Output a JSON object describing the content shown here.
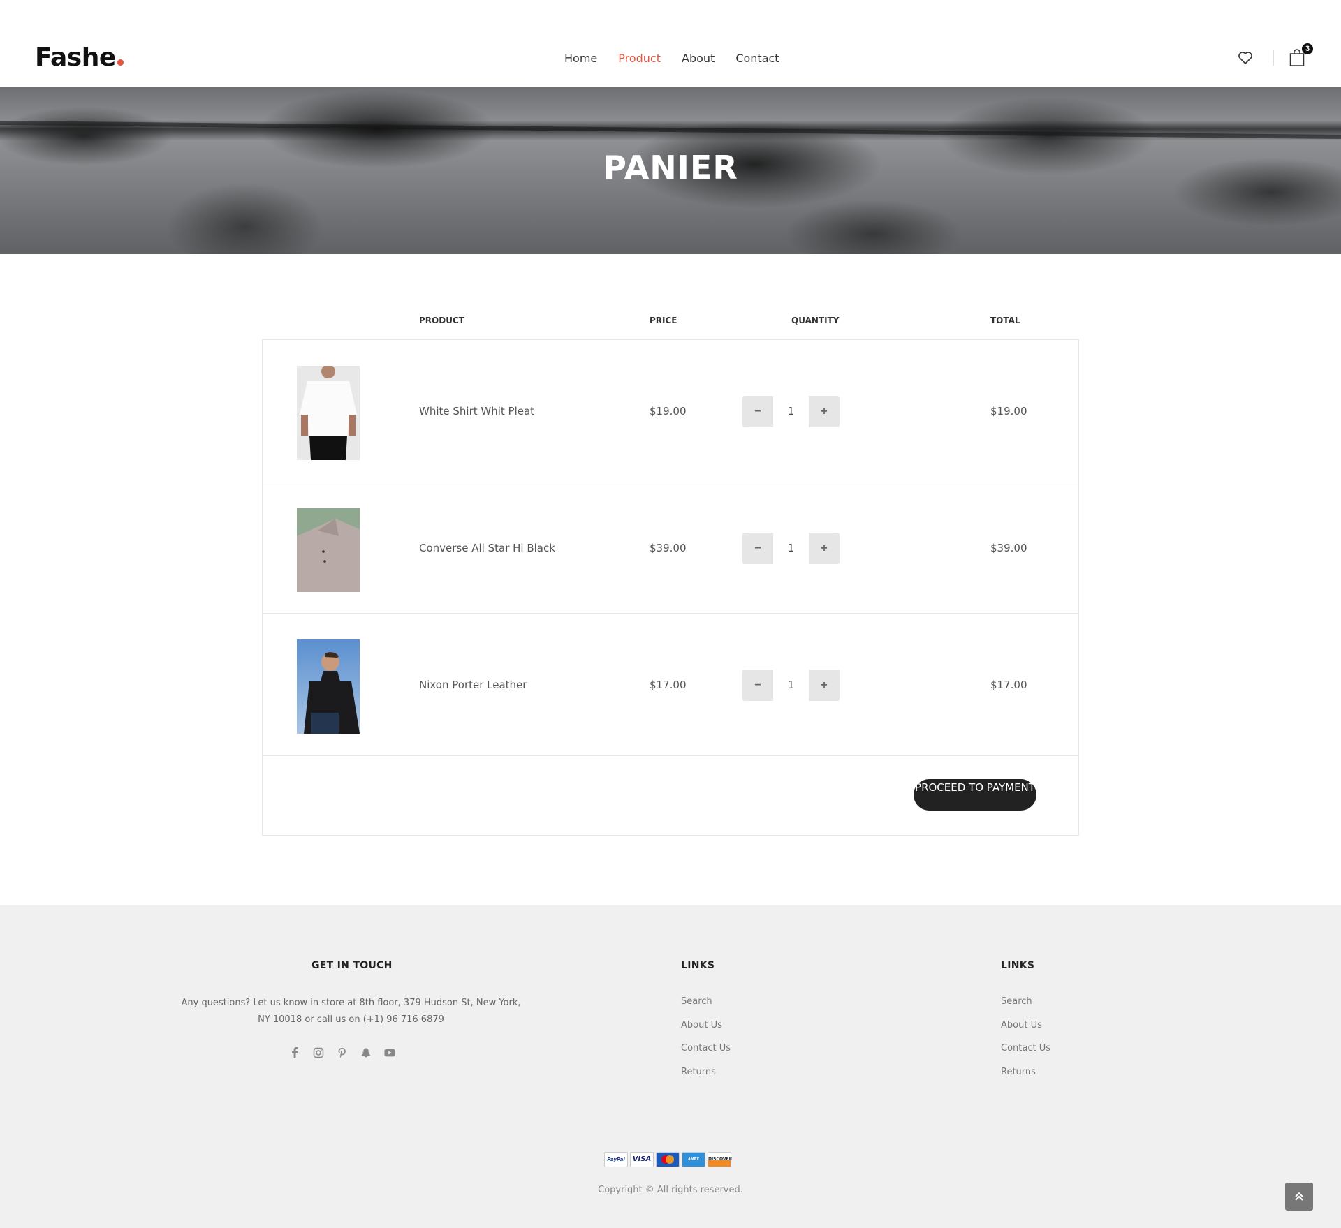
{
  "header": {
    "logo": "Fashe",
    "nav": [
      "Home",
      "Product",
      "About",
      "Contact"
    ],
    "active_nav": "Product",
    "cart_count": "3"
  },
  "hero": {
    "title": "PANIER"
  },
  "cart": {
    "columns": {
      "product": "PRODUCT",
      "price": "PRICE",
      "quantity": "QUANTITY",
      "total": "TOTAL"
    },
    "items": [
      {
        "name": "White Shirt Whit Pleat",
        "price": "$19.00",
        "quantity": "1",
        "total": "$19.00",
        "image": "white-tshirt-photo"
      },
      {
        "name": "Converse All Star Hi Black",
        "price": "$39.00",
        "quantity": "1",
        "total": "$39.00",
        "image": "beige-polo-photo"
      },
      {
        "name": "Nixon Porter Leather",
        "price": "$17.00",
        "quantity": "1",
        "total": "$17.00",
        "image": "man-black-polo-photo"
      }
    ],
    "proceed_label": "PROCEED TO PAYMENT"
  },
  "footer": {
    "contact_title": "GET IN TOUCH",
    "contact_text": "Any questions? Let us know in store at 8th floor, 379 Hudson St, New York, NY 10018 or call us on (+1) 96 716 6879",
    "socials": [
      "facebook-icon",
      "instagram-icon",
      "pinterest-icon",
      "snapchat-icon",
      "youtube-icon"
    ],
    "links_col1": {
      "title": "LINKS",
      "items": [
        "Search",
        "About Us",
        "Contact Us",
        "Returns"
      ]
    },
    "links_col2": {
      "title": "LINKS",
      "items": [
        "Search",
        "About Us",
        "Contact Us",
        "Returns"
      ]
    },
    "payments": [
      "PayPal",
      "VISA",
      "MasterCard",
      "AmericanExpress",
      "DISCOVER"
    ],
    "copyright": "Copyright © All rights reserved."
  },
  "colors": {
    "accent": "#e65540",
    "dark": "#222222",
    "footer_bg": "#f0f0f0"
  }
}
